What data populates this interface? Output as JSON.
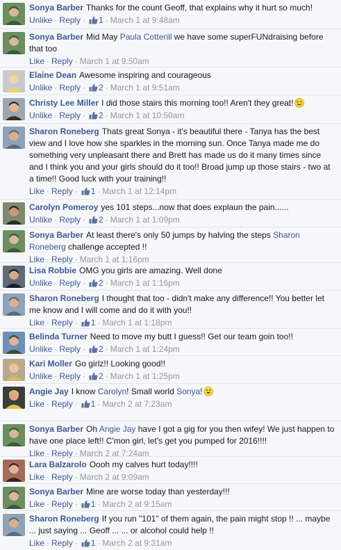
{
  "ui": {
    "like_label": "Like",
    "unlike_label": "Unlike",
    "reply_label": "Reply",
    "separator": "·",
    "colors": {
      "link": "#3b5998",
      "meta": "#9197a3",
      "text": "#141823",
      "background": "#f6f7f9"
    }
  },
  "comments": [
    {
      "author": "Sonya Barber",
      "parts": [
        {
          "t": "Thanks for the count Geoff, that explains why it hurt so much!"
        }
      ],
      "action": "Unlike",
      "likes": "1",
      "time": "March 1 at 9:48am",
      "avatar": "avatar-sonya"
    },
    {
      "author": "Sonya Barber",
      "parts": [
        {
          "t": "Mid May "
        },
        {
          "t": "Paula Cotterill",
          "m": 1
        },
        {
          "t": " we have some superFUNdraising before that too"
        }
      ],
      "action": "Like",
      "likes": "",
      "time": "March 1 at 9:50am",
      "avatar": "avatar-sonya"
    },
    {
      "author": "Elaine Dean",
      "parts": [
        {
          "t": "Awesome inspiring and courageous"
        }
      ],
      "action": "Unlike",
      "likes": "2",
      "time": "March 1 at 9:51am",
      "avatar": "avatar-elaine"
    },
    {
      "author": "Christy Lee Miller",
      "parts": [
        {
          "t": "I did those stairs this morning too!! Aren't they great!"
        }
      ],
      "emoji": "wink-emoji",
      "action": "Unlike",
      "likes": "2",
      "time": "March 1 at 10:50am",
      "avatar": "avatar-christy"
    },
    {
      "author": "Sharon Roneberg",
      "parts": [
        {
          "t": "Thats great Sonya - it's beautiful there - Tanya has the best view and I love how she sparkles in the morning sun. Once Tanya made me do something very unpleasant there and Brett has made us do it many times since and I think you and your girls should do it too!! Broad jump up those stairs - two at a time!! Good luck with your training!!"
        }
      ],
      "action": "Like",
      "likes": "1",
      "time": "March 1 at 12:14pm",
      "avatar": "avatar-sharon"
    },
    {
      "author": "Carolyn Pomeroy",
      "parts": [
        {
          "t": "yes 101 steps...now that does explaun the pain......"
        }
      ],
      "action": "Unlike",
      "likes": "2",
      "time": "March 1 at 1:09pm",
      "avatar": "avatar-carolyn"
    },
    {
      "author": "Sonya Barber",
      "parts": [
        {
          "t": "At least there's only 50 jumps by halving the steps "
        },
        {
          "t": "Sharon Roneberg",
          "m": 1
        },
        {
          "t": " challenge accepted !!"
        }
      ],
      "action": "Like",
      "likes": "",
      "time": "March 1 at 1:16pm",
      "avatar": "avatar-sonya"
    },
    {
      "author": "Lisa Robbie",
      "parts": [
        {
          "t": "OMG you girls are amazing. Well done"
        }
      ],
      "action": "Unlike",
      "likes": "2",
      "time": "March 1 at 1:16pm",
      "avatar": "avatar-lisa"
    },
    {
      "author": "Sharon Roneberg",
      "parts": [
        {
          "t": "I thought that too - didn't make any difference!! You better let me know and I will come and do it with you!!"
        }
      ],
      "action": "Like",
      "likes": "1",
      "time": "March 1 at 1:18pm",
      "avatar": "avatar-sharon"
    },
    {
      "author": "Belinda Turner",
      "parts": [
        {
          "t": "Need to move my butt I guess!! Get our team goin too!!"
        }
      ],
      "action": "Unlike",
      "likes": "2",
      "time": "March 1 at 1:24pm",
      "avatar": "avatar-belinda"
    },
    {
      "author": "Kari Moller",
      "parts": [
        {
          "t": "Go girlz!! Looking good!!"
        }
      ],
      "action": "Unlike",
      "likes": "2",
      "time": "March 1 at 1:25pm",
      "avatar": "avatar-kari"
    },
    {
      "author": "Angie Jay",
      "parts": [
        {
          "t": "I know "
        },
        {
          "t": "Carolyn",
          "m": 1
        },
        {
          "t": "! Small world "
        },
        {
          "t": "Sonya",
          "m": 1
        },
        {
          "t": "!"
        }
      ],
      "emoji": "smile-emoji",
      "action": "Like",
      "likes": "1",
      "time": "March 2 at 7:23am",
      "avatar": "avatar-angie"
    },
    {
      "author": "Sonya Barber",
      "parts": [
        {
          "t": "Oh "
        },
        {
          "t": "Angie Jay",
          "m": 1
        },
        {
          "t": " have I got a gig for you then wifey! We just happen to have one place left!! C'mon girl, let's get you pumped for 2016!!!!"
        }
      ],
      "action": "Like",
      "likes": "",
      "time": "March 2 at 7:24am",
      "avatar": "avatar-sonya"
    },
    {
      "author": "Lara Balzarolo",
      "parts": [
        {
          "t": "Oooh my calves hurt today!!!!"
        }
      ],
      "action": "Like",
      "likes": "",
      "time": "March 2 at 9:09am",
      "avatar": "avatar-lara"
    },
    {
      "author": "Sonya Barber",
      "parts": [
        {
          "t": "Mine are worse today than yesterday!!!"
        }
      ],
      "action": "Like",
      "likes": "1",
      "time": "March 2 at 9:15am",
      "avatar": "avatar-sonya"
    },
    {
      "author": "Sharon Roneberg",
      "parts": [
        {
          "t": "If you run \"101\" of them again, the pain might stop !! ... maybe ... just saying ... Geoff ... ... or alcohol could help !!"
        }
      ],
      "action": "Like",
      "likes": "1",
      "time": "March 2 at 9:31am",
      "avatar": "avatar-sharon"
    }
  ]
}
